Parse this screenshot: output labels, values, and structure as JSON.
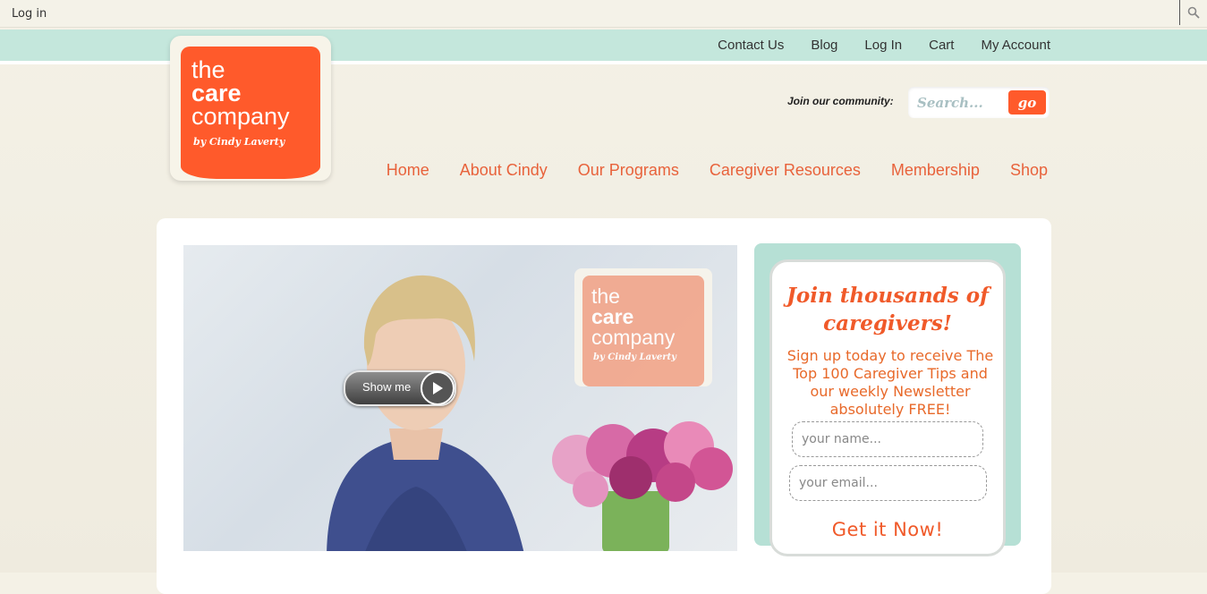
{
  "admin_bar": {
    "login_label": "Log in",
    "search_icon": "search-icon"
  },
  "top_nav": [
    "Contact Us",
    "Blog",
    "Log In",
    "Cart",
    "My Account"
  ],
  "logo": {
    "line1": "the",
    "line2": "care",
    "line3": "company",
    "tagline": "by Cindy Laverty"
  },
  "search": {
    "join_label": "Join our community:",
    "placeholder": "Search...",
    "go_label": "go"
  },
  "main_nav": [
    "Home",
    "About Cindy",
    "Our Programs",
    "Caregiver Resources",
    "Membership",
    "Shop"
  ],
  "video": {
    "button_label": "Show me",
    "logo": {
      "line1": "the",
      "line2": "care",
      "line3": "company",
      "tagline": "by Cindy Laverty"
    }
  },
  "signup": {
    "title": "Join thousands of caregivers!",
    "description": "Sign up today to receive The Top 100 Caregiver Tips and our weekly Newsletter absolutely FREE!",
    "name_placeholder": "your name...",
    "email_placeholder": "your email...",
    "submit_label": "Get it Now!"
  },
  "colors": {
    "accent": "#ff5a2b",
    "teal": "#c4e7dc",
    "nav_text": "#e8623b"
  }
}
